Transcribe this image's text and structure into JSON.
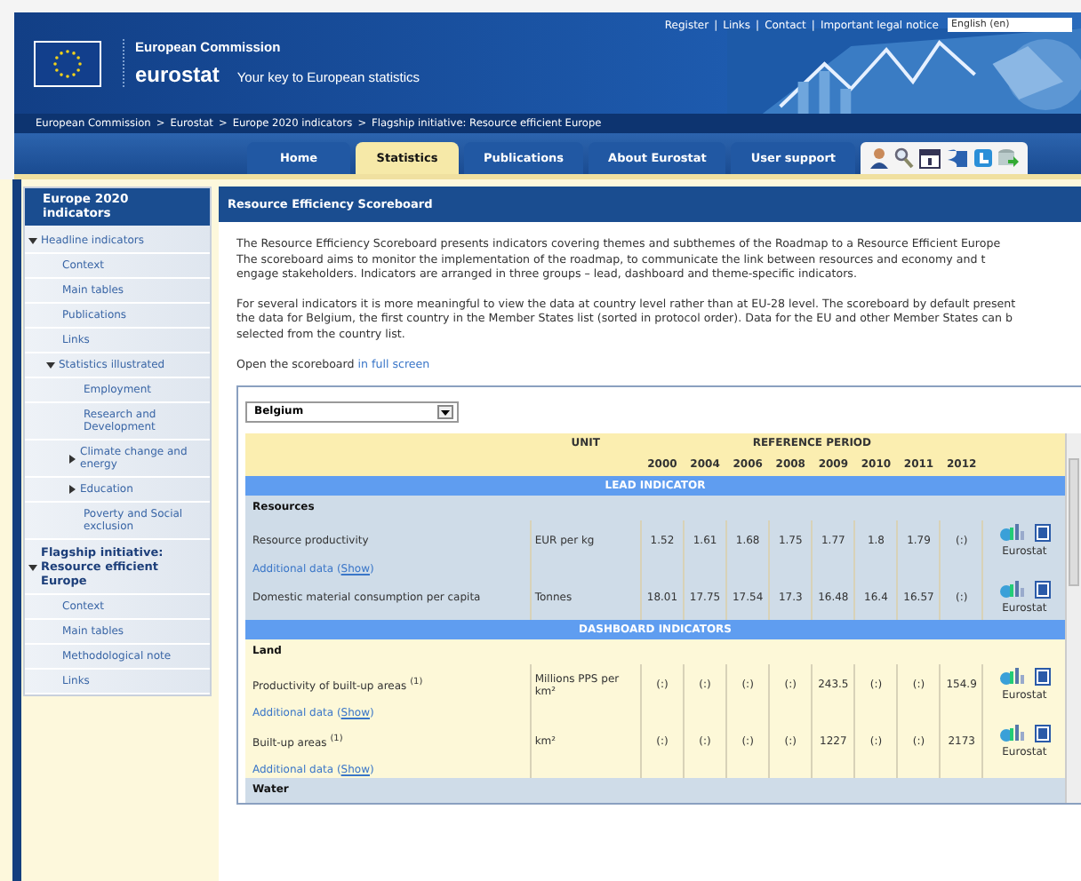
{
  "header": {
    "top_links": [
      "Register",
      "Links",
      "Contact",
      "Important legal notice"
    ],
    "link_separator": "|",
    "language": "English (en)",
    "org": "European Commission",
    "brand": "eurostat",
    "tagline": "Your key to European statistics"
  },
  "breadcrumb": {
    "separator": ">",
    "items": [
      "European Commission",
      "Eurostat",
      "Europe 2020 indicators",
      "Flagship initiative: Resource efficient Europe"
    ]
  },
  "tabs": [
    {
      "label": "Home",
      "selected": false
    },
    {
      "label": "Statistics",
      "selected": true
    },
    {
      "label": "Publications",
      "selected": false
    },
    {
      "label": "About Eurostat",
      "selected": false
    },
    {
      "label": "User support",
      "selected": false
    }
  ],
  "sidebar": {
    "title": "Europe 2020 indicators",
    "items": [
      {
        "label": "Headline indicators",
        "kind": "link",
        "expanded": true,
        "children": [
          {
            "label": "Context",
            "kind": "link"
          },
          {
            "label": "Main tables",
            "kind": "link"
          },
          {
            "label": "Publications",
            "kind": "link"
          },
          {
            "label": "Links",
            "kind": "link"
          },
          {
            "label": "Statistics illustrated",
            "kind": "link",
            "expanded": true,
            "children": [
              {
                "label": "Employment",
                "kind": "link"
              },
              {
                "label": "Research and Development",
                "kind": "link"
              },
              {
                "label": "Climate change and energy",
                "kind": "link",
                "expanded": false
              },
              {
                "label": "Education",
                "kind": "link",
                "expanded": false
              },
              {
                "label": "Poverty and Social exclusion",
                "kind": "link"
              }
            ]
          }
        ]
      },
      {
        "label": "Flagship initiative: Resource efficient Europe",
        "kind": "heading",
        "expanded": true,
        "children": [
          {
            "label": "Context",
            "kind": "link"
          },
          {
            "label": "Main tables",
            "kind": "link"
          },
          {
            "label": "Methodological note",
            "kind": "link"
          },
          {
            "label": "Links",
            "kind": "link"
          }
        ]
      }
    ]
  },
  "main": {
    "title": "Resource Efficiency Scoreboard",
    "paragraphs": [
      [
        "The Resource Efficiency Scoreboard presents indicators covering themes and subthemes of the Roadmap to a Resource Efficient Europe",
        "The scoreboard aims to monitor the implementation of the roadmap, to communicate the link between resources and economy and t",
        "engage stakeholders. Indicators are arranged in three groups – lead, dashboard and theme-specific indicators."
      ],
      [
        "For several indicators it is more meaningful to view the data at country level rather than at EU-28 level. The scoreboard by default present",
        "the data for Belgium, the first country in the Member States list (sorted in protocol order). Data for the EU and other Member States can b",
        "selected from the country list."
      ]
    ],
    "open_text": "Open the scoreboard",
    "open_link": "in full screen"
  },
  "scoreboard": {
    "country": "Belgium",
    "unit_header": "UNIT",
    "period_header": "REFERENCE PERIOD",
    "years": [
      "2000",
      "2004",
      "2006",
      "2008",
      "2009",
      "2010",
      "2011",
      "2012"
    ],
    "groups": [
      {
        "title": "LEAD INDICATOR",
        "color": "#cfdce8",
        "themes": [
          {
            "name": "Resources",
            "indicators": [
              {
                "name": "Resource productivity",
                "unit": "EUR per kg",
                "values": [
                  "1.52",
                  "1.61",
                  "1.68",
                  "1.75",
                  "1.77",
                  "1.8",
                  "1.79",
                  "(:)"
                ],
                "source": "Eurostat",
                "additional": "Additional data (",
                "show": "Show",
                "additional_end": ")"
              },
              {
                "name": "Domestic material consumption per capita",
                "unit": "Tonnes",
                "values": [
                  "18.01",
                  "17.75",
                  "17.54",
                  "17.3",
                  "16.48",
                  "16.4",
                  "16.57",
                  "(:)"
                ],
                "source": "Eurostat"
              }
            ]
          }
        ]
      },
      {
        "title": "DASHBOARD INDICATORS",
        "color": "#fdf8d8",
        "themes": [
          {
            "name": "Land",
            "indicators": [
              {
                "name": "Productivity of built-up areas $^{(1)}$",
                "unit": "Millions PPS per km²",
                "values": [
                  "(:)",
                  "(:)",
                  "(:)",
                  "(:)",
                  "243.5",
                  "(:)",
                  "(:)",
                  "154.9"
                ],
                "source": "Eurostat",
                "additional": "Additional data (",
                "show": "Show",
                "additional_end": ")"
              },
              {
                "name": "Built-up areas $^{(1)}$",
                "unit": "km²",
                "values": [
                  "(:)",
                  "(:)",
                  "(:)",
                  "(:)",
                  "1227",
                  "(:)",
                  "(:)",
                  "2173"
                ],
                "source": "Eurostat",
                "additional": "Additional data (",
                "show": "Show",
                "additional_end": ")"
              }
            ]
          },
          {
            "name": "Water",
            "color": "#cfdce8"
          }
        ]
      }
    ]
  }
}
